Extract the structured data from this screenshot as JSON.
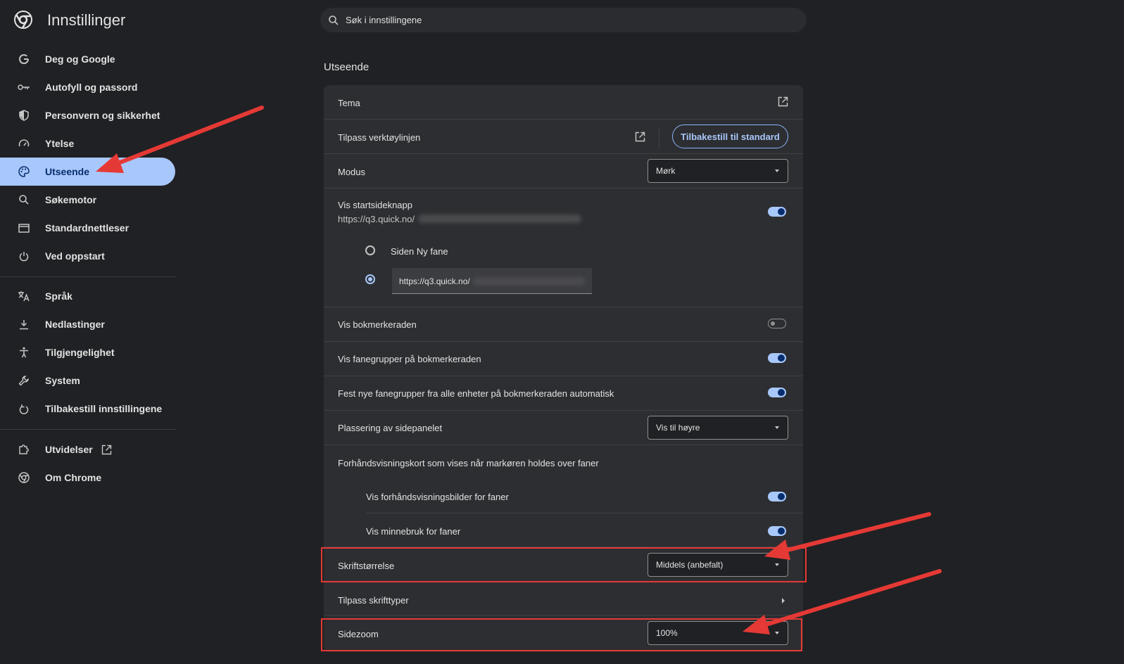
{
  "header": {
    "title": "Innstillinger",
    "search_placeholder": "Søk i innstillingene"
  },
  "sidebar": {
    "items": [
      {
        "label": "Deg og Google",
        "icon": "google-icon"
      },
      {
        "label": "Autofyll og passord",
        "icon": "key-icon"
      },
      {
        "label": "Personvern og sikkerhet",
        "icon": "shield-icon"
      },
      {
        "label": "Ytelse",
        "icon": "speedometer-icon"
      },
      {
        "label": "Utseende",
        "icon": "palette-icon",
        "active": true
      },
      {
        "label": "Søkemotor",
        "icon": "search-icon"
      },
      {
        "label": "Standardnettleser",
        "icon": "browser-window-icon"
      },
      {
        "label": "Ved oppstart",
        "icon": "power-icon"
      },
      {
        "label": "Språk",
        "icon": "translate-icon"
      },
      {
        "label": "Nedlastinger",
        "icon": "download-icon"
      },
      {
        "label": "Tilgjengelighet",
        "icon": "accessibility-icon"
      },
      {
        "label": "System",
        "icon": "wrench-icon"
      },
      {
        "label": "Tilbakestill innstillingene",
        "icon": "reset-icon"
      },
      {
        "label": "Utvidelser",
        "icon": "puzzle-icon"
      },
      {
        "label": "Om Chrome",
        "icon": "chrome-icon"
      }
    ]
  },
  "main": {
    "section_title": "Utseende",
    "rows": {
      "tema": "Tema",
      "toolbar": "Tilpass verktøylinjen",
      "reset_button": "Tilbakestill til standard",
      "modus": "Modus",
      "modus_value": "Mørk",
      "home_button": "Vis startsideknapp",
      "home_url": "https://q3.quick.no/",
      "radio_new_tab": "Siden Ny fane",
      "custom_url_value": "https://q3.quick.no/",
      "bookmarks_bar": "Vis bokmerkeraden",
      "tab_groups": "Vis fanegrupper på bokmerkeraden",
      "pin_groups": "Fest nye fanegrupper fra alle enheter på bokmerkeraden automatisk",
      "side_panel": "Plassering av sidepanelet",
      "side_panel_value": "Vis til høyre",
      "hover_cards": "Forhåndsvisningskort som vises når markøren holdes over faner",
      "hover_images": "Vis forhåndsvisningsbilder for faner",
      "hover_memory": "Vis minnebruk for faner",
      "font_size": "Skriftstørrelse",
      "font_size_value": "Middels (anbefalt)",
      "customize_fonts": "Tilpass skrifttyper",
      "page_zoom": "Sidezoom",
      "page_zoom_value": "100%"
    },
    "toggles": {
      "home_button": true,
      "bookmarks_bar": false,
      "tab_groups": true,
      "pin_groups": true,
      "hover_images": true,
      "hover_memory": true
    }
  },
  "colors": {
    "background": "#202124",
    "card": "#2d2e31",
    "accent": "#a8c7fa",
    "annotation": "#e53935"
  }
}
